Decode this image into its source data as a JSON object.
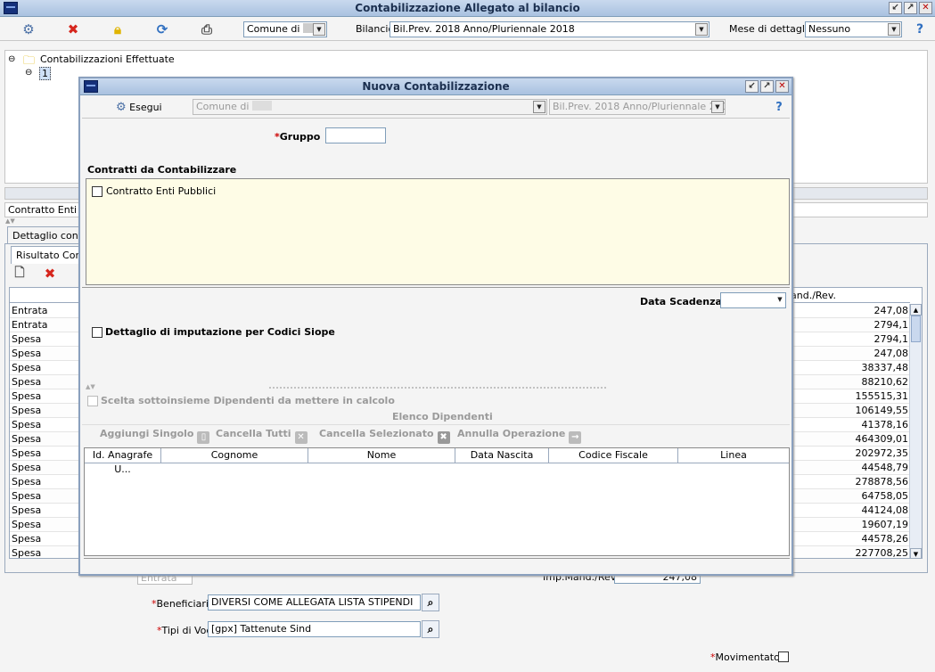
{
  "main": {
    "title": "Contabilizzazione Allegato al bilancio",
    "toolbar": {
      "comune_value": "Comune di",
      "bilancio_label": "Bilancio",
      "bilancio_value": "Bil.Prev. 2018 Anno/Pluriennale 2018",
      "mese_label": "Mese di dettaglio",
      "mese_value": "Nessuno"
    },
    "tree": {
      "root_label": "Contabilizzazioni Effettuate",
      "child_label": "1"
    },
    "contratto_text": "Contratto Enti Pu",
    "tab_dettaglio": "Dettaglio conta",
    "tab_risultato": "Risultato Cont",
    "grid_header_right": "and./Rev.",
    "rows": [
      {
        "type": "Entrata",
        "amount": "247,08"
      },
      {
        "type": "Entrata",
        "amount": "2794,1"
      },
      {
        "type": "Spesa",
        "amount": "2794,1"
      },
      {
        "type": "Spesa",
        "amount": "247,08"
      },
      {
        "type": "Spesa",
        "amount": "38337,48"
      },
      {
        "type": "Spesa",
        "amount": "88210,62"
      },
      {
        "type": "Spesa",
        "amount": "155515,31"
      },
      {
        "type": "Spesa",
        "amount": "106149,55"
      },
      {
        "type": "Spesa",
        "amount": "41378,16"
      },
      {
        "type": "Spesa",
        "amount": "464309,01"
      },
      {
        "type": "Spesa",
        "amount": "202972,35"
      },
      {
        "type": "Spesa",
        "amount": "44548,79"
      },
      {
        "type": "Spesa",
        "amount": "278878,56"
      },
      {
        "type": "Spesa",
        "amount": "64758,05"
      },
      {
        "type": "Spesa",
        "amount": "44124,08"
      },
      {
        "type": "Spesa",
        "amount": "19607,19"
      },
      {
        "type": "Spesa",
        "amount": "44578,26"
      },
      {
        "type": "Spesa",
        "amount": "227708,25"
      }
    ],
    "form": {
      "entrata_value": "Entrata",
      "imp_label": "Imp.Mand./Rev.",
      "imp_value": "247,08",
      "beneficiario_label": "Beneficiario",
      "beneficiario_value": "DIVERSI COME ALLEGATA LISTA STIPENDI",
      "tipi_label": "Tipi di Voci",
      "tipi_value": "[gpx] Tattenute Sind",
      "movimentato_label": "Movimentato"
    }
  },
  "dialog": {
    "title": "Nuova Contabilizzazione",
    "esegui_label": "Esegui",
    "comune_value": "Comune di",
    "bilancio_value": "Bil.Prev. 2018 Anno/Pluriennale 2018",
    "gruppo_label": "Gruppo",
    "contratti_header": "Contratti da Contabilizzare",
    "contratto_option": "Contratto Enti Pubblici",
    "data_scadenza_label": "Data Scadenza",
    "dettaglio_siope_label": "Dettaglio di imputazione per Codici Siope",
    "scelta_label": "Scelta sottoinsieme Dipendenti da mettere in calcolo",
    "elenco_label": "Elenco Dipendenti",
    "btn_aggiungi": "Aggiungi Singolo",
    "btn_cancella_tutti": "Cancella Tutti",
    "btn_cancella_sel": "Cancella Selezionato",
    "btn_annulla": "Annulla Operazione",
    "columns": [
      "Id. Anagrafe U...",
      "Cognome",
      "Nome",
      "Data Nascita",
      "Codice Fiscale",
      "Linea"
    ]
  },
  "colors": {
    "title_bg": "#b9cde8",
    "contratti_bg": "#fefce6",
    "required": "#cc0000"
  }
}
